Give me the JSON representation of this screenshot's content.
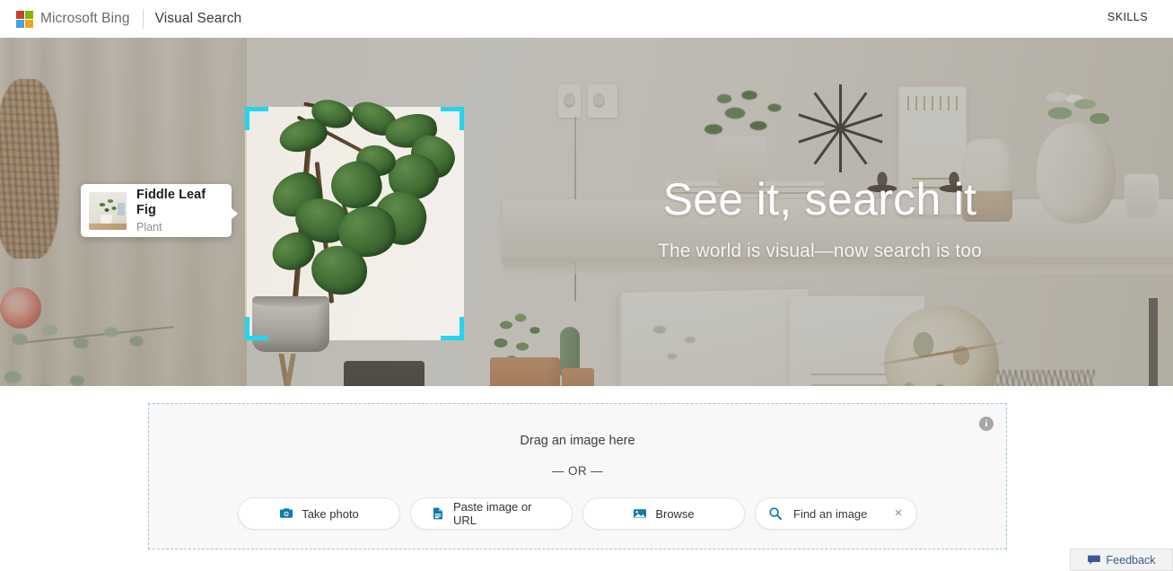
{
  "header": {
    "logo_icon": "microsoft-squares-icon",
    "brand": "Microsoft Bing",
    "product": "Visual Search",
    "skills": "SKILLS",
    "logo_colors": {
      "red": "#c8432b",
      "green": "#7cb900",
      "blue": "#45a3e0",
      "yellow": "#e9a623"
    }
  },
  "hero": {
    "title": "See it, search it",
    "subtitle": "The world is visual—now search is too",
    "crop_accent_color": "#25d4ef",
    "crop_bracket_icon": "crop-corner-icon",
    "entity_card": {
      "title": "Fiddle Leaf Fig",
      "subtitle": "Plant",
      "thumb_icon": "plant-thumbnail-icon"
    }
  },
  "dropzone": {
    "drag_text": "Drag an image here",
    "or_text": "— OR —",
    "info_icon": "info-icon",
    "info_glyph": "i",
    "border_color": "#9cc8e2",
    "icon_color": "#0f7ab0",
    "buttons": [
      {
        "label": "Take photo",
        "icon": "camera-icon"
      },
      {
        "label": "Paste image or URL",
        "icon": "paste-document-icon"
      },
      {
        "label": "Browse",
        "icon": "image-icon"
      },
      {
        "label": "Find an image",
        "icon": "search-icon",
        "clear_icon": "close-icon",
        "clear_glyph": "×"
      }
    ]
  },
  "feedback": {
    "label": "Feedback",
    "icon": "feedback-bubble-icon",
    "color": "#3b5998"
  }
}
